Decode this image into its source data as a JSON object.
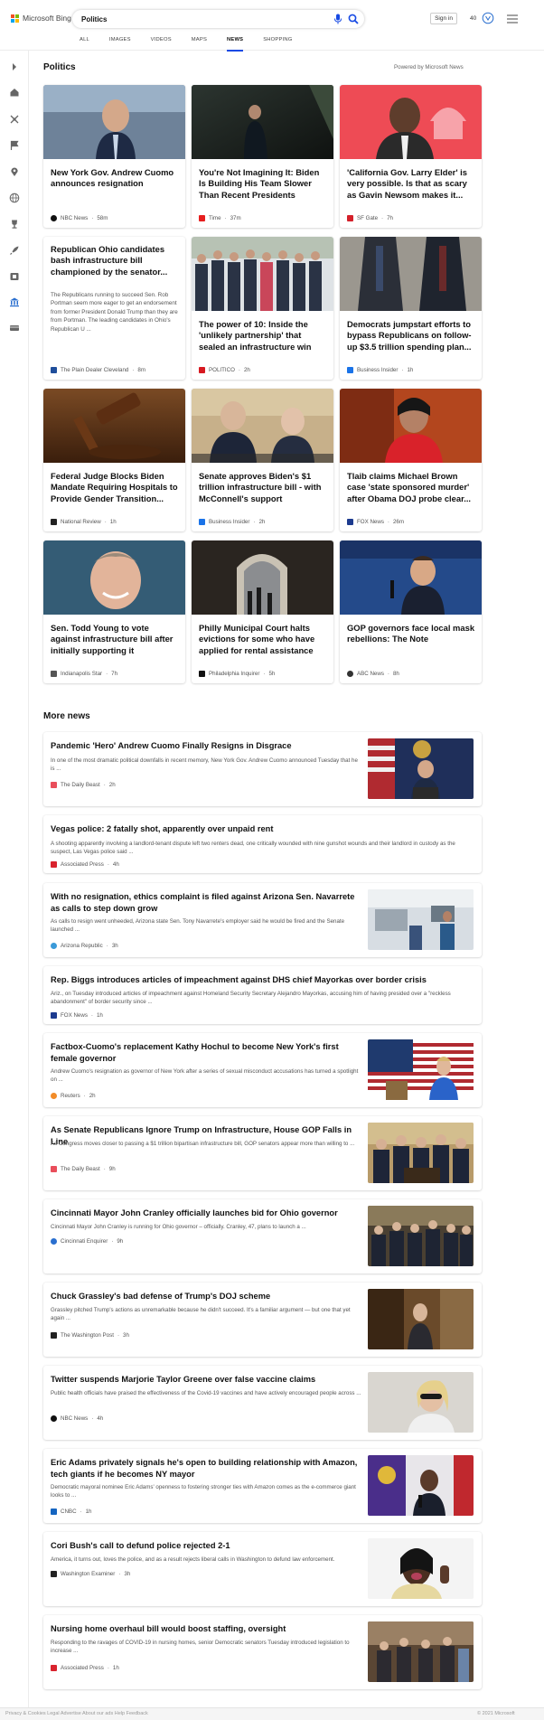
{
  "header": {
    "brand": "Microsoft Bing",
    "search_value": "Politics",
    "signin_label": "Sign in",
    "points": "40",
    "tabs": [
      "ALL",
      "IMAGES",
      "VIDEOS",
      "MAPS",
      "NEWS",
      "SHOPPING"
    ],
    "active_tab": "NEWS"
  },
  "sidebar": {
    "icons": [
      "chevron-right-icon",
      "home-icon",
      "discover-icon",
      "flag-icon",
      "location-pin-icon",
      "globe-icon",
      "trophy-icon",
      "rocket-icon",
      "film-icon",
      "politics-icon",
      "money-icon"
    ]
  },
  "top": {
    "title": "Politics",
    "powered_by": "Powered by Microsoft News",
    "cards": [
      {
        "title": "New York Gov. Andrew Cuomo announces resignation",
        "source": "NBC News",
        "time": "58m",
        "snippet": "",
        "thumb": "cuomo",
        "source_color": "#111111"
      },
      {
        "title": "You're Not Imagining It: Biden Is Building His Team Slower Than Recent Presidents",
        "source": "Time",
        "time": "37m",
        "snippet": "",
        "thumb": "biden-dark",
        "source_color": "#e61e1e"
      },
      {
        "title": "'California Gov. Larry Elder' is very possible. Is that as scary as Gavin Newsom makes it...",
        "source": "SF Gate",
        "time": "7h",
        "snippet": "",
        "thumb": "elder",
        "source_color": "#d4202a"
      },
      {
        "title": "Republican Ohio candidates bash infrastructure bill championed by the senator...",
        "source": "The Plain Dealer Cleveland",
        "time": "8m",
        "snippet": "The Republicans running to succeed Sen. Rob Portman seem more eager to get an endorsement from former President Donald Trump than they are from Portman. The leading candidates in Ohio's Republican U ...",
        "thumb": "",
        "source_color": "#1f4e9b"
      },
      {
        "title": "The power of 10: Inside the 'unlikely partnership' that sealed an infrastructure win",
        "source": "POLITICO",
        "time": "2h",
        "snippet": "",
        "thumb": "group",
        "source_color": "#d71920"
      },
      {
        "title": "Democrats jumpstart efforts to bypass Republicans on follow-up $3.5 trillion spending plan...",
        "source": "Business Insider",
        "time": "1h",
        "snippet": "",
        "thumb": "suits",
        "source_color": "#1a73e8"
      },
      {
        "title": "Federal Judge Blocks Biden Mandate Requiring Hospitals to Provide Gender Transition...",
        "source": "National Review",
        "time": "1h",
        "snippet": "",
        "thumb": "gavel",
        "source_color": "#222222"
      },
      {
        "title": "Senate approves Biden's $1 trillion infrastructure bill - with McConnell's support",
        "source": "Business Insider",
        "time": "2h",
        "snippet": "",
        "thumb": "schumer",
        "source_color": "#1a73e8"
      },
      {
        "title": "Tlaib claims Michael Brown case 'state sponsored murder' after Obama DOJ probe clear...",
        "source": "FOX News",
        "time": "26m",
        "snippet": "",
        "thumb": "tlaib",
        "source_color": "#1d3b8f"
      },
      {
        "title": "Sen. Todd Young to vote against infrastructure bill after initially supporting it",
        "source": "Indianapolis Star",
        "time": "7h",
        "snippet": "",
        "thumb": "young",
        "source_color": "#555555"
      },
      {
        "title": "Philly Municipal Court halts evictions for some who have applied for rental assistance",
        "source": "Philadelphia Inquirer",
        "time": "5h",
        "snippet": "",
        "thumb": "court",
        "source_color": "#111111"
      },
      {
        "title": "GOP governors face local mask rebellions: The Note",
        "source": "ABC News",
        "time": "8h",
        "snippet": "",
        "thumb": "desantis",
        "source_color": "#333333"
      }
    ]
  },
  "more": {
    "title": "More news",
    "items": [
      {
        "title": "Pandemic 'Hero' Andrew Cuomo Finally Resigns in Disgrace",
        "snippet": "In one of the most dramatic political downfalls in recent memory, New York Gov. Andrew Cuomo announced Tuesday that he is ...",
        "source": "The Daily Beast",
        "time": "2h",
        "thumb": "cuomo-podium",
        "source_color": "#e94e5b"
      },
      {
        "title": "Vegas police: 2 fatally shot, apparently over unpaid rent",
        "snippet": "A shooting apparently involving a landlord-tenant dispute left two renters dead, one critically wounded with nine gunshot wounds and their landlord in custody as the suspect, Las Vegas police said ...",
        "source": "Associated Press",
        "time": "4h",
        "thumb": "",
        "source_color": "#d9232e"
      },
      {
        "title": "With no resignation, ethics complaint is filed against Arizona Sen. Navarrete as calls to step down grow",
        "snippet": "As calls to resign went unheeded, Arizona state Sen. Tony Navarrete's employer said he would be fired and the Senate launched ...",
        "source": "Arizona Republic",
        "time": "3h",
        "thumb": "office",
        "source_color": "#3a9ad9"
      },
      {
        "title": "Rep. Biggs introduces articles of impeachment against DHS chief Mayorkas over border crisis",
        "snippet": "Ariz., on Tuesday introduced articles of impeachment against Homeland Security Secretary Alejandro Mayorkas, accusing him of having presided over a \"reckless abandonment\" of border security since ...",
        "source": "FOX News",
        "time": "1h",
        "thumb": "",
        "source_color": "#1d3b8f"
      },
      {
        "title": "Factbox-Cuomo's replacement Kathy Hochul to become New York's first female governor",
        "snippet": "Andrew Cuomo's resignation as governor of New York after a series of sexual misconduct accusations has turned a spotlight on ...",
        "source": "Reuters",
        "time": "2h",
        "thumb": "hochul",
        "source_color": "#f28c28"
      },
      {
        "title": "As Senate Republicans Ignore Trump on Infrastructure, House GOP Falls in Line",
        "snippet": "As Congress moves closer to passing a $1 trillion bipartisan infrastructure bill, GOP senators appear more than willing to ...",
        "source": "The Daily Beast",
        "time": "9h",
        "thumb": "senators",
        "source_color": "#e94e5b"
      },
      {
        "title": "Cincinnati Mayor John Cranley officially launches bid for Ohio governor",
        "snippet": "Cincinnati Mayor John Cranley is running for Ohio governor – officially.  Cranley, 47, plans to launch a ...",
        "source": "Cincinnati Enquirer",
        "time": "9h",
        "thumb": "cranley",
        "source_color": "#2a6fcf"
      },
      {
        "title": "Chuck Grassley's bad defense of Trump's DOJ scheme",
        "snippet": "Grassley pitched Trump's actions as unremarkable because he didn't succeed. It's a familiar argument — but one that yet again ...",
        "source": "The Washington Post",
        "time": "3h",
        "thumb": "grassley",
        "source_color": "#222222"
      },
      {
        "title": "Twitter suspends Marjorie Taylor Greene over false vaccine claims",
        "snippet": "Public health officials have praised the effectiveness of the Covid-19 vaccines and have actively encouraged people across ...",
        "source": "NBC News",
        "time": "4h",
        "thumb": "greene",
        "source_color": "#111111"
      },
      {
        "title": "Eric Adams privately signals he's open to building relationship with Amazon, tech giants if he becomes NY mayor",
        "snippet": "Democratic mayoral nominee Eric Adams' openness to fostering stronger ties with Amazon comes as the e-commerce giant looks to ...",
        "source": "CNBC",
        "time": "1h",
        "thumb": "adams",
        "source_color": "#1565c0"
      },
      {
        "title": "Cori Bush's call to defund police rejected 2-1",
        "snippet": "America, it turns out, loves the police, and as a result rejects liberal calls in Washington to defund law enforcement.",
        "source": "Washington Examiner",
        "time": "3h",
        "thumb": "bush",
        "source_color": "#222222"
      },
      {
        "title": "Nursing home overhaul bill would boost staffing, oversight",
        "snippet": "Responding to the ravages of COVID-19 in nursing homes, senior Democratic senators Tuesday introduced legislation to increase ...",
        "source": "Associated Press",
        "time": "1h",
        "thumb": "nursing",
        "source_color": "#d9232e"
      }
    ]
  },
  "footer": {
    "left": "Privacy & Cookies   Legal   Advertise   About our ads   Help   Feedback",
    "right": "© 2021 Microsoft"
  }
}
